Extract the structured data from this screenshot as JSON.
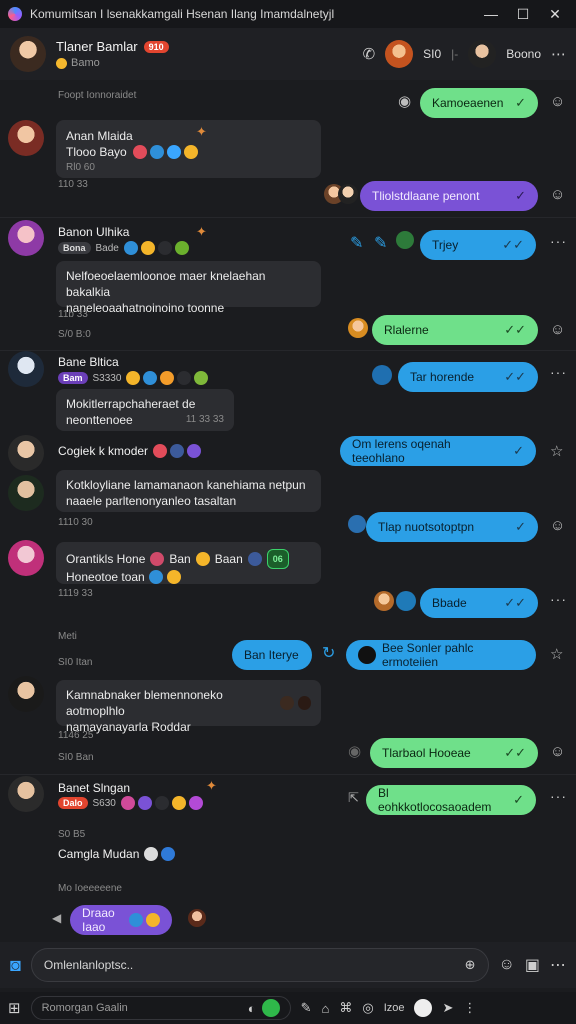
{
  "window": {
    "title": "Komumitsan I lsenakkamgali Hsenan Ilang Imamdalnetyjl",
    "controls": [
      "—",
      "☐",
      "✕"
    ]
  },
  "header": {
    "contact_name": "Tlaner Bamlar",
    "contact_tag": "910",
    "status": "Bamo",
    "right_label": "SI0",
    "right_sep": "|-",
    "right_name": "Boono",
    "tag_color": "#e2452f"
  },
  "messages": {
    "sys1": "Foopt Ionnoraidet",
    "out1": "Kamoeaenen",
    "m1": {
      "name": "Anan Mlaida",
      "line1": "Tlooo Bayo",
      "line2": "Rl0 60",
      "ts": "110 33"
    },
    "out2": "Tliolstdlaane penont",
    "m2": {
      "name": "Banon Ulhika",
      "tag": "Bona",
      "tag_num": "Bade",
      "text1": "Nelfoeoelaemloonoe maer knelaehan bakalkia",
      "text2": "naneleoaahatnoinoino toonne",
      "ts1": "11b 33",
      "ts2": "S/0 B:0"
    },
    "out3": "Trjey",
    "out4": "Rlalerne",
    "m3": {
      "name": "Bane Bltica",
      "tag": "Bam",
      "tag_num": "S3330",
      "text1": "Mokitlerrapchaheraet de",
      "text2": "neonttenoee",
      "ts": "11 33 33"
    },
    "out5": "Tar horende",
    "m4": {
      "name": "Cogiek k kmoder",
      "text1": "Kotkloyliane lamamanaon kanehiama netpun",
      "text2": "naaele parltenonyanleo tasaltan",
      "ts": "1110 30"
    },
    "out6": "Om lerens oqenah teeohlano",
    "out7": "Tlap nuotsotoptpn",
    "m5": {
      "name": "Orantikls Hone",
      "extra1": "Ban",
      "extra2": "Baan",
      "tag": "06",
      "text1": "Honeotoe toan",
      "ts": "1119 33"
    },
    "out8": "Bbade",
    "sys2": "Meti",
    "ts_m6": "SI0 Itan",
    "out9": "Ban Iterye",
    "out10": "Bee Sonler pahlc ermoteiien",
    "m6": {
      "text1": "Kamnabnaker blemennoneko aotmoplhlo",
      "text2": "namayanayarla Roddar",
      "ts1": "1146 25",
      "ts2": "SI0 Ban"
    },
    "out11": "Tlarbaol Hooeae",
    "m7": {
      "name": "Banet Slngan",
      "tag": "Dalo",
      "tag_num": "S630",
      "ts": "S0 B5"
    },
    "out12": "Bl eohkkotlocosaoadem",
    "m8": {
      "name": "Camgla Mudan"
    },
    "sys3": "Mo Ioeeeeene",
    "out13": "Draao Iaao"
  },
  "composer": {
    "placeholder": "Omlenlanloptsc.."
  },
  "bottom": {
    "search": "Romorgan Gaalin",
    "right_label": "Izoe"
  }
}
